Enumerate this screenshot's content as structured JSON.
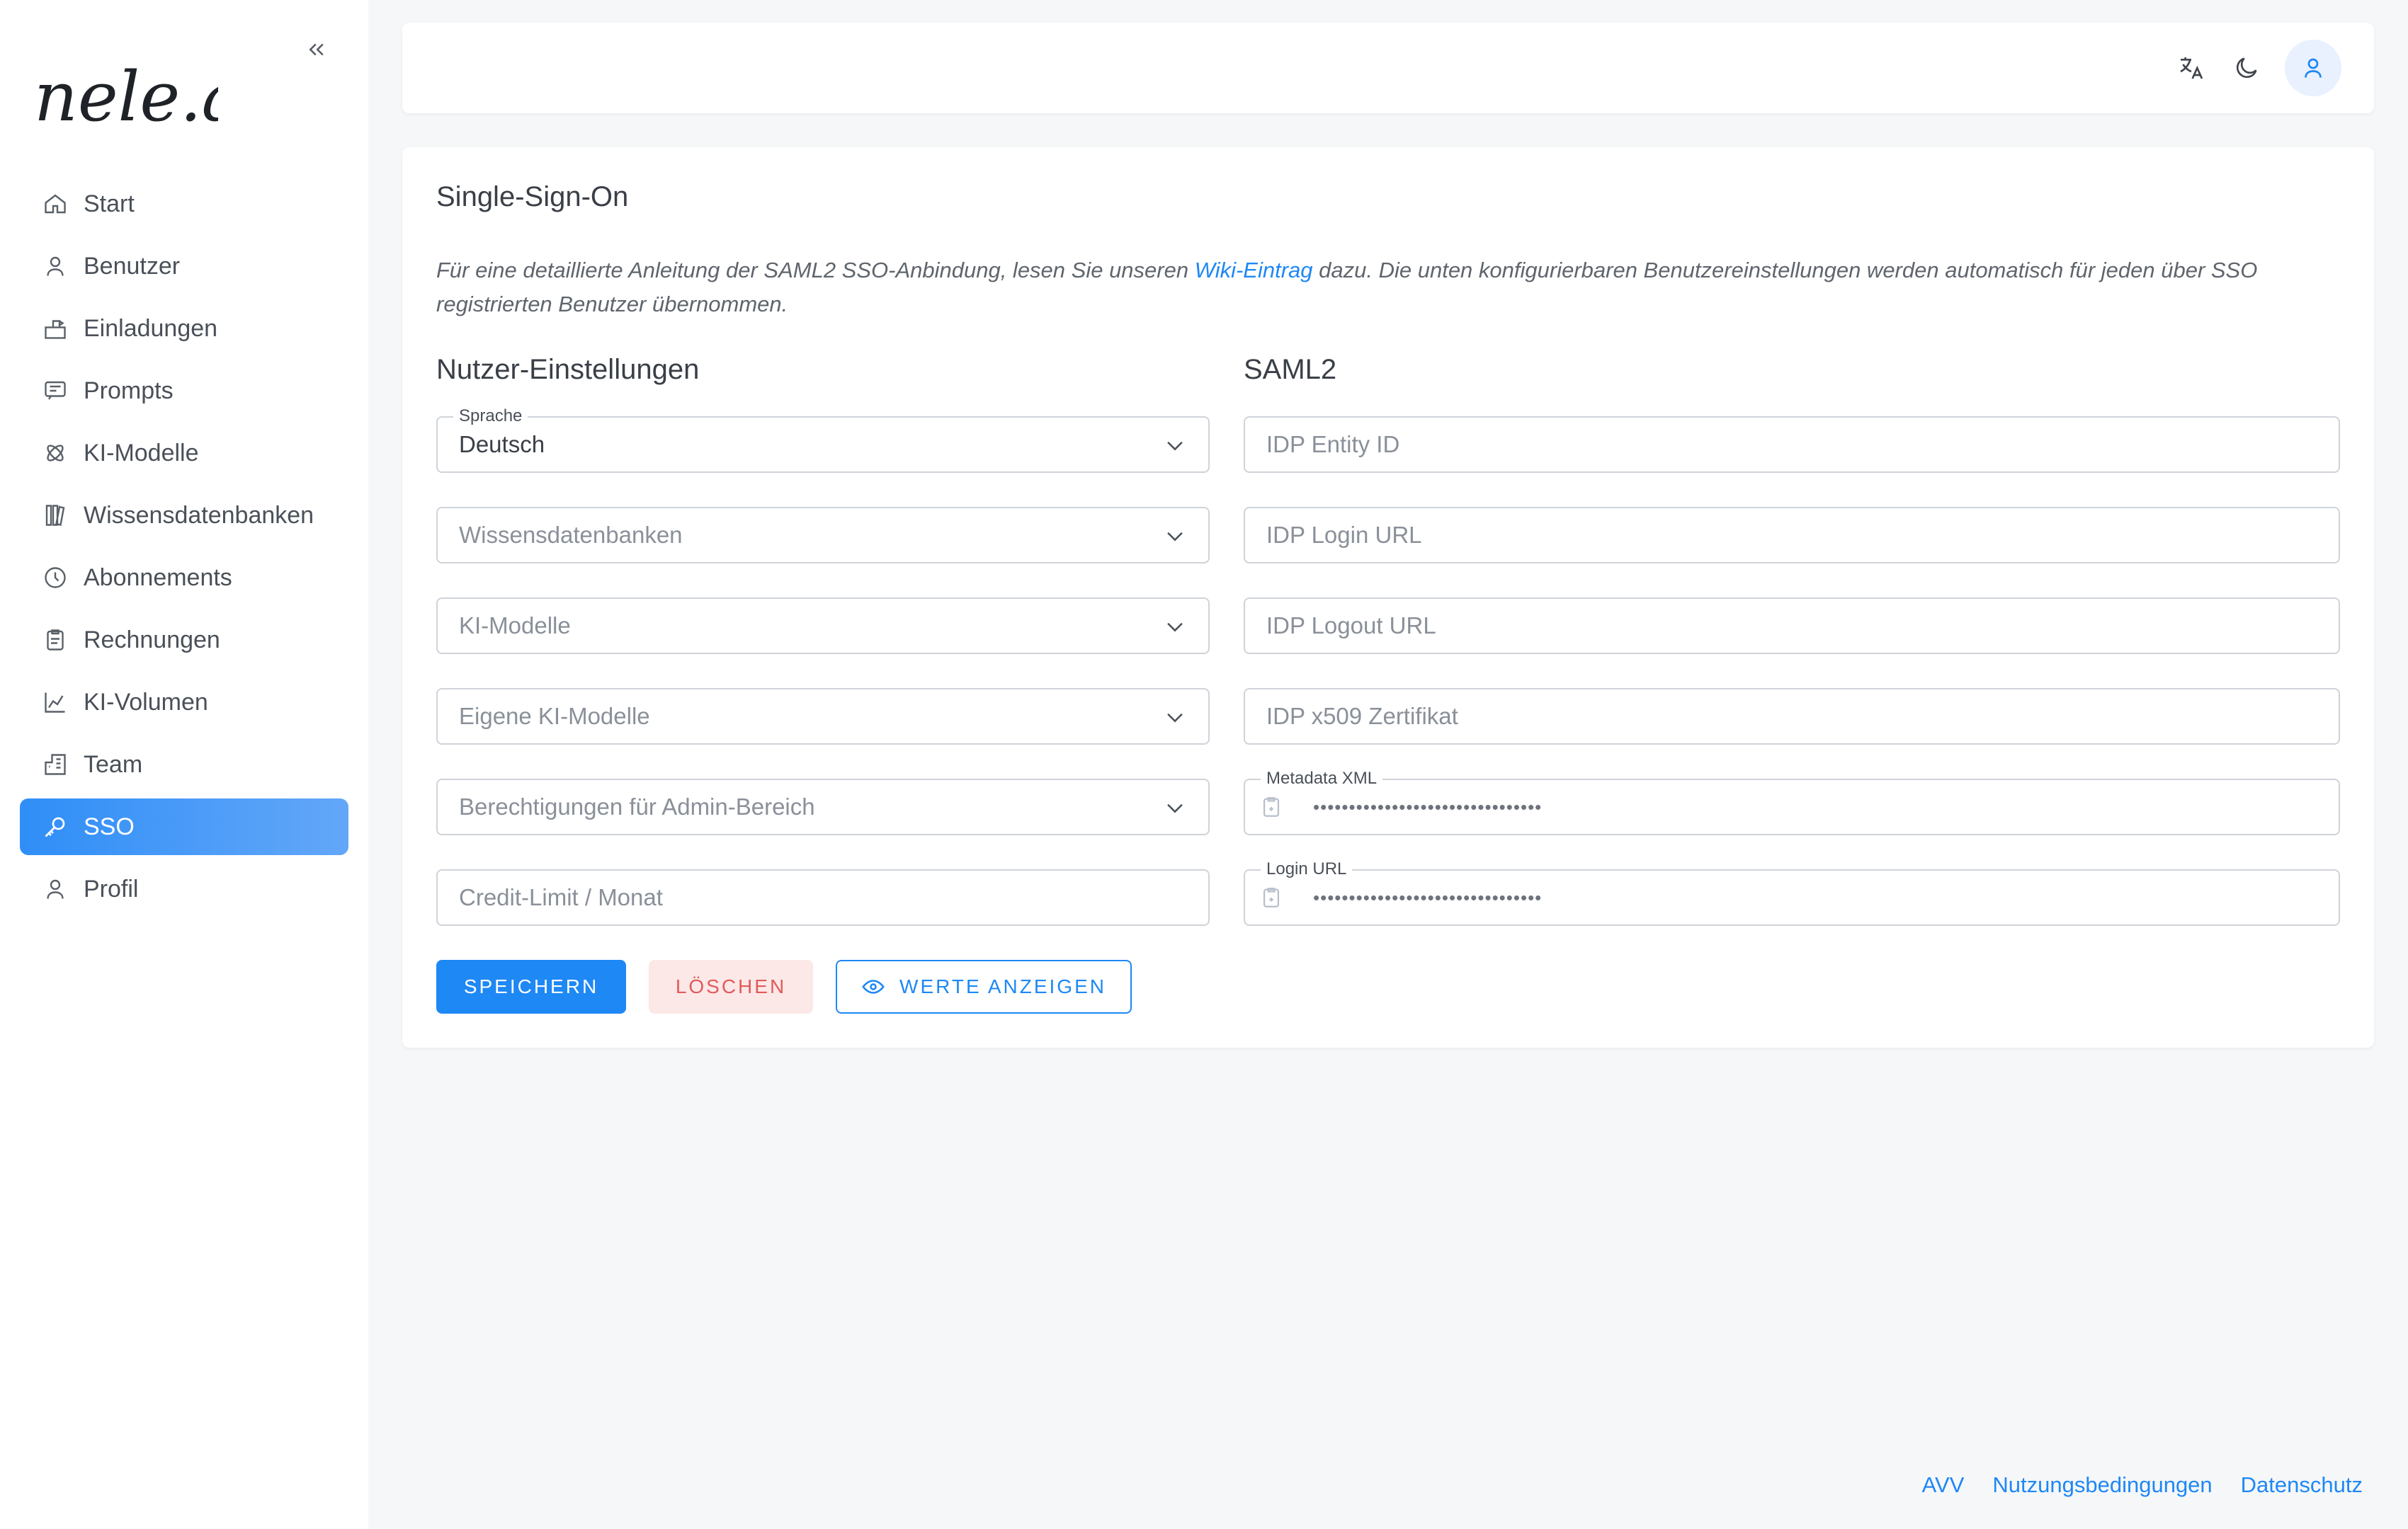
{
  "sidebar": {
    "logo_text": "nele.ai",
    "items": [
      {
        "label": "Start",
        "icon": "home-icon"
      },
      {
        "label": "Benutzer",
        "icon": "user-icon"
      },
      {
        "label": "Einladungen",
        "icon": "invite-icon"
      },
      {
        "label": "Prompts",
        "icon": "prompt-icon"
      },
      {
        "label": "KI-Modelle",
        "icon": "atom-icon"
      },
      {
        "label": "Wissensdatenbanken",
        "icon": "library-icon"
      },
      {
        "label": "Abonnements",
        "icon": "clock-icon"
      },
      {
        "label": "Rechnungen",
        "icon": "clipboard-icon"
      },
      {
        "label": "KI-Volumen",
        "icon": "chart-icon"
      },
      {
        "label": "Team",
        "icon": "building-icon"
      },
      {
        "label": "SSO",
        "icon": "key-icon",
        "active": true
      },
      {
        "label": "Profil",
        "icon": "user-icon"
      }
    ]
  },
  "main": {
    "title": "Single-Sign-On",
    "description": {
      "before": "Für eine detaillierte Anleitung der SAML2 SSO-Anbindung, lesen Sie unseren ",
      "link": "Wiki-Eintrag",
      "after": " dazu. Die unten konfigurierbaren Benutzereinstellungen werden automatisch für jeden über SSO registrierten Benutzer übernommen."
    },
    "left_title": "Nutzer-Einstellungen",
    "right_title": "SAML2",
    "fields_left": {
      "language": {
        "label": "Sprache",
        "value": "Deutsch"
      },
      "knowledge": {
        "placeholder": "Wissensdatenbanken"
      },
      "models": {
        "placeholder": "KI-Modelle"
      },
      "own_models": {
        "placeholder": "Eigene KI-Modelle"
      },
      "permissions": {
        "placeholder": "Berechtigungen für Admin-Bereich"
      },
      "credit_limit": {
        "placeholder": "Credit-Limit / Monat"
      }
    },
    "fields_right": {
      "entity_id": {
        "placeholder": "IDP Entity ID"
      },
      "login_url": {
        "placeholder": "IDP Login URL"
      },
      "logout_url": {
        "placeholder": "IDP Logout URL"
      },
      "x509": {
        "placeholder": "IDP x509 Zertifikat"
      },
      "metadata_xml": {
        "label": "Metadata XML",
        "value": "••••••••••••••••••••••••••••••••"
      },
      "sp_login_url": {
        "label": "Login URL",
        "value": "••••••••••••••••••••••••••••••••"
      }
    },
    "buttons": {
      "save": "SPEICHERN",
      "delete": "LÖSCHEN",
      "show": "WERTE ANZEIGEN"
    }
  },
  "footer": {
    "links": [
      "AVV",
      "Nutzungsbedingungen",
      "Datenschutz"
    ]
  },
  "colors": {
    "accent": "#1e88f5",
    "danger_bg": "#fde8e8",
    "danger_text": "#e15b5b"
  }
}
